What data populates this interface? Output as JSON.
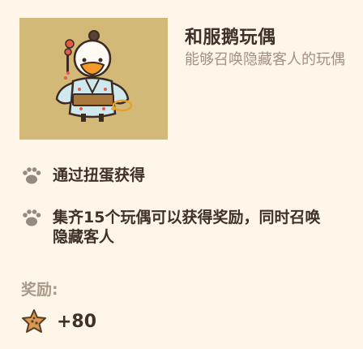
{
  "item": {
    "title": "和服鹅玩偶",
    "description": "能够召唤隐藏客人的玩偶",
    "image_icon": "kimono-goose-doll"
  },
  "info": [
    {
      "icon": "paw-icon",
      "text": "通过扭蛋获得"
    },
    {
      "icon": "paw-icon",
      "text": "集齐15个玩偶可以获得奖励，同时召唤隐藏客人"
    }
  ],
  "reward": {
    "label": "奖励:",
    "icon": "star-cookie-icon",
    "value": "+80"
  },
  "colors": {
    "background": "#fdf6e9",
    "image_background": "#d2b978",
    "title": "#3f302a",
    "description": "#a48f83",
    "reward_label": "#a9998c"
  }
}
